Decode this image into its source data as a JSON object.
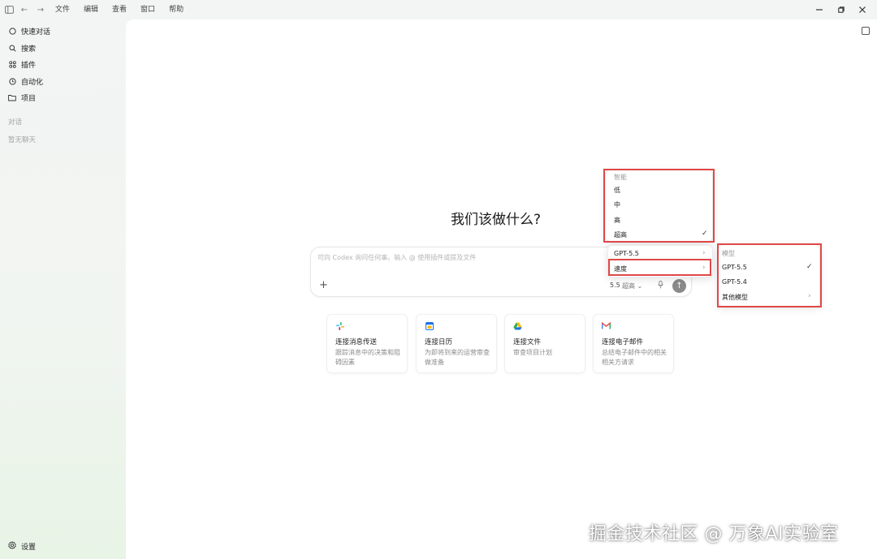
{
  "titlebar": {
    "menu": [
      "文件",
      "编辑",
      "查看",
      "窗口",
      "帮助"
    ]
  },
  "sidebar": {
    "items": [
      {
        "label": "快速对话",
        "icon": "chat-bubble-icon"
      },
      {
        "label": "搜索",
        "icon": "search-icon"
      },
      {
        "label": "插件",
        "icon": "grid-icon"
      },
      {
        "label": "自动化",
        "icon": "clock-icon"
      },
      {
        "label": "项目",
        "icon": "folder-icon"
      }
    ],
    "section_label": "对话",
    "empty_label": "暂无聊天",
    "settings_label": "设置"
  },
  "main": {
    "headline": "我们该做什么?",
    "composer": {
      "placeholder": "可向 Codex 询问任何事。输入 @ 使用插件或提及文件",
      "model": "5.5",
      "effort": "超高 ⌄"
    },
    "cards": [
      {
        "title": "连接消息传送",
        "desc": "跟踪消息中的决策和阻碍因素",
        "icon": "slack-icon",
        "color": "#e01e5a"
      },
      {
        "title": "连接日历",
        "desc": "为即将到来的运营审查做准备",
        "icon": "calendar-icon",
        "color": "#1a73e8"
      },
      {
        "title": "连接文件",
        "desc": "审查项目计划",
        "icon": "drive-icon",
        "color": "#34a853"
      },
      {
        "title": "连接电子邮件",
        "desc": "总结电子邮件中的相关相关方请求",
        "icon": "gmail-icon",
        "color": "#ea4335"
      }
    ]
  },
  "effort_menu": {
    "header": "智能",
    "items": [
      "低",
      "中",
      "高",
      "超高"
    ],
    "selected": "超高"
  },
  "model_menu": {
    "items": [
      "GPT-5.5",
      "速度"
    ]
  },
  "model_submenu": {
    "header": "模型",
    "items": [
      "GPT-5.5",
      "GPT-5.4",
      "其他模型"
    ],
    "selected": "GPT-5.5"
  },
  "watermark": "掘金技术社区 @ 万象AI实验室",
  "colors": {
    "highlight": "#e04848",
    "accent": "#8a8a8a"
  }
}
